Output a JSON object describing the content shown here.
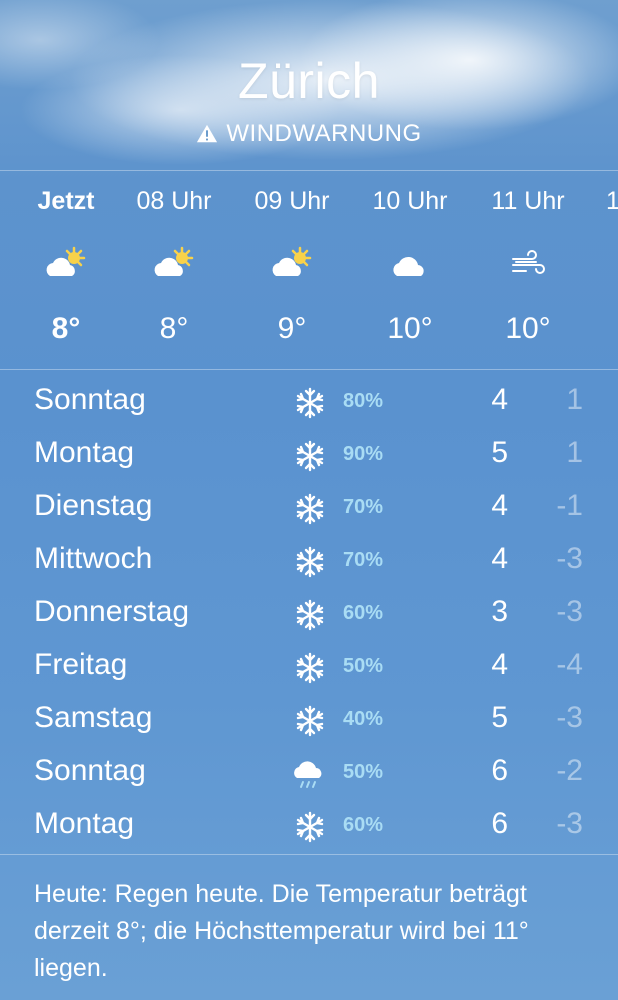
{
  "header": {
    "city": "Zürich",
    "alert": "WINDWARNUNG"
  },
  "hourly": [
    {
      "time": "Jetzt",
      "icon": "partly-sunny-icon",
      "temp": "8°"
    },
    {
      "time": "08 Uhr",
      "icon": "partly-sunny-icon",
      "temp": "8°"
    },
    {
      "time": "09 Uhr",
      "icon": "partly-sunny-icon",
      "temp": "9°"
    },
    {
      "time": "10 Uhr",
      "icon": "cloud-icon",
      "temp": "10°"
    },
    {
      "time": "11 Uhr",
      "icon": "wind-icon",
      "temp": "10°"
    },
    {
      "time": "1",
      "icon": "",
      "temp": ""
    }
  ],
  "daily": [
    {
      "day": "Sonntag",
      "icon": "snowflake-icon",
      "prob": "80%",
      "hi": "4",
      "lo": "1"
    },
    {
      "day": "Montag",
      "icon": "snowflake-icon",
      "prob": "90%",
      "hi": "5",
      "lo": "1"
    },
    {
      "day": "Dienstag",
      "icon": "snowflake-icon",
      "prob": "70%",
      "hi": "4",
      "lo": "-1"
    },
    {
      "day": "Mittwoch",
      "icon": "snowflake-icon",
      "prob": "70%",
      "hi": "4",
      "lo": "-3"
    },
    {
      "day": "Donnerstag",
      "icon": "snowflake-icon",
      "prob": "60%",
      "hi": "3",
      "lo": "-3"
    },
    {
      "day": "Freitag",
      "icon": "snowflake-icon",
      "prob": "50%",
      "hi": "4",
      "lo": "-4"
    },
    {
      "day": "Samstag",
      "icon": "snowflake-icon",
      "prob": "40%",
      "hi": "5",
      "lo": "-3"
    },
    {
      "day": "Sonntag",
      "icon": "rain-cloud-icon",
      "prob": "50%",
      "hi": "6",
      "lo": "-2"
    },
    {
      "day": "Montag",
      "icon": "snowflake-icon",
      "prob": "60%",
      "hi": "6",
      "lo": "-3"
    }
  ],
  "summary": "Heute: Regen heute. Die Temperatur beträgt derzeit 8°; die Höchsttemperatur wird bei 11° liegen.",
  "colors": {
    "background": "#5a92cf",
    "probability": "#a9dcf4",
    "sun": "#f8d24a"
  }
}
